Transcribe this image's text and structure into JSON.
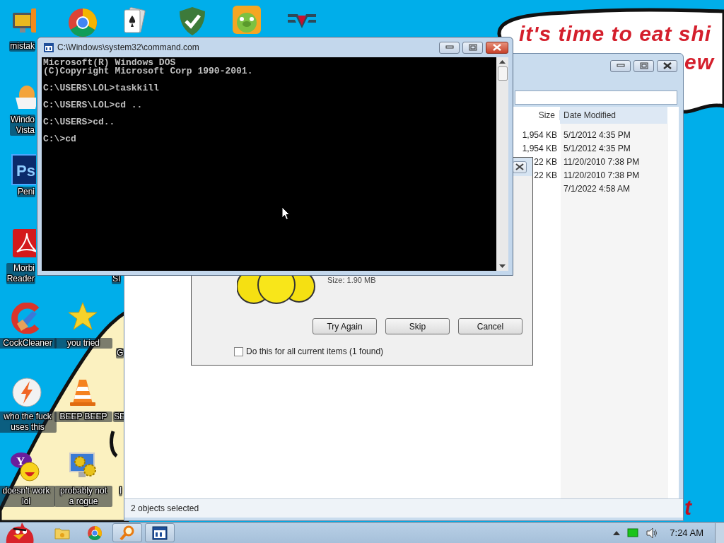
{
  "desktop_icons": [
    {
      "kind": "computer",
      "label_lines": [
        "mistak"
      ]
    },
    {
      "kind": "chrome"
    },
    {
      "kind": "cards"
    },
    {
      "kind": "shield"
    },
    {
      "kind": "pig"
    },
    {
      "kind": "emblem"
    },
    {
      "kind": "egg",
      "label_lines": [
        "Windo",
        "Vista"
      ]
    },
    {
      "kind": "photoshop",
      "badge_text": "Ps",
      "label_lines": [
        "Peni"
      ]
    },
    {
      "kind": "acrobat",
      "label_lines": [
        "Morbi",
        "Reader"
      ]
    },
    {
      "kind": "covered",
      "label_lines": [
        "SI"
      ]
    },
    {
      "kind": "ccleaner",
      "label_lines": [
        "CockCleaner"
      ]
    },
    {
      "kind": "star",
      "label_lines": [
        "you tried"
      ]
    },
    {
      "kind": "covered",
      "label_lines": [
        "G"
      ]
    },
    {
      "kind": "bolt",
      "label_lines": [
        "who the fuck",
        "uses this"
      ]
    },
    {
      "kind": "cone",
      "label_lines": [
        "BEEP BEEP"
      ]
    },
    {
      "kind": "covered",
      "label_lines": [
        "SE"
      ]
    },
    {
      "kind": "messenger",
      "badge_text": "Y",
      "label_lines": [
        "doesn't work",
        "lol"
      ]
    },
    {
      "kind": "gears",
      "label_lines": [
        "probably not",
        "a rogue"
      ]
    },
    {
      "kind": "covered",
      "label_lines": [
        "I"
      ]
    }
  ],
  "wallpaper": {
    "bubble_lines": [
      "it's time to eat shi",
      "ew"
    ],
    "bottom_fragment": "t"
  },
  "explorer": {
    "columns": [
      "Size",
      "Date Modified"
    ],
    "rows": [
      {
        "size": "1,954 KB",
        "date": "5/1/2012 4:35 PM"
      },
      {
        "size": "1,954 KB",
        "date": "5/1/2012 4:35 PM"
      },
      {
        "size": "22 KB",
        "date": "11/20/2010 7:38 PM"
      },
      {
        "size": "22 KB",
        "date": "11/20/2010 7:38 PM"
      },
      {
        "date": "7/1/2022 4:58 AM"
      }
    ],
    "status": "2 objects selected"
  },
  "dialog": {
    "file_size": "Size: 1.90 MB",
    "buttons": [
      "Try Again",
      "Skip",
      "Cancel"
    ],
    "apply_all": {
      "label": "Do this for all current items (1 found)",
      "checked": false
    }
  },
  "console": {
    "title": "C:\\Windows\\system32\\command.com",
    "blocks": [
      [
        "Microsoft(R) Windows DOS",
        "(C)Copyright Microsoft Corp 1990-2001."
      ],
      [
        "C:\\USERS\\LOL>taskkill"
      ],
      [
        "C:\\USERS\\LOL>cd .."
      ],
      [
        "C:\\USERS>cd.."
      ],
      [
        "C:\\>cd"
      ]
    ]
  },
  "taskbar": {
    "buttons": [
      {
        "kind": "folder",
        "running": false
      },
      {
        "kind": "chrome",
        "running": false
      },
      {
        "kind": "search",
        "running": true
      },
      {
        "kind": "console",
        "running": true
      }
    ],
    "clock": "7:24 AM"
  }
}
